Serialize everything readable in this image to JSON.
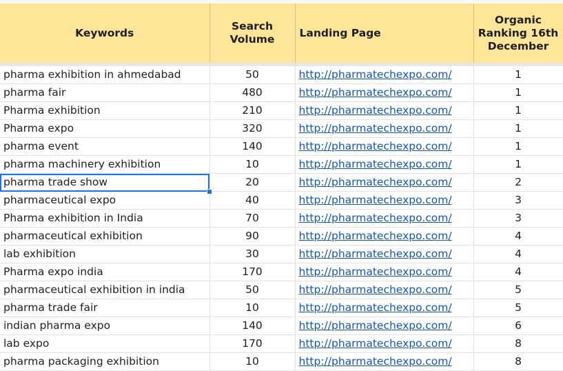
{
  "headers": {
    "keywords": "Keywords",
    "search_volume": "Search Volume",
    "landing_page": "Landing Page",
    "organic_ranking": "Organic Ranking 16th December"
  },
  "rows": [
    {
      "keyword": "pharma exhibition in ahmedabad",
      "volume": "50",
      "url": "http://pharmatechexpo.com/",
      "rank": "1"
    },
    {
      "keyword": "pharma fair",
      "volume": "480",
      "url": "http://pharmatechexpo.com/",
      "rank": "1"
    },
    {
      "keyword": "Pharma exhibition",
      "volume": "210",
      "url": "http://pharmatechexpo.com/",
      "rank": "1"
    },
    {
      "keyword": "Pharma expo",
      "volume": "320",
      "url": "http://pharmatechexpo.com/",
      "rank": "1"
    },
    {
      "keyword": "pharma event",
      "volume": "140",
      "url": "http://pharmatechexpo.com/",
      "rank": "1"
    },
    {
      "keyword": "pharma machinery exhibition",
      "volume": "10",
      "url": "http://pharmatechexpo.com/",
      "rank": "1"
    },
    {
      "keyword": "pharma trade show",
      "volume": "20",
      "url": "http://pharmatechexpo.com/",
      "rank": "2"
    },
    {
      "keyword": "pharmaceutical expo",
      "volume": "40",
      "url": "http://pharmatechexpo.com/",
      "rank": "3"
    },
    {
      "keyword": "Pharma exhibition in India",
      "volume": "70",
      "url": "http://pharmatechexpo.com/",
      "rank": "3"
    },
    {
      "keyword": "pharmaceutical exhibition",
      "volume": "90",
      "url": "http://pharmatechexpo.com/",
      "rank": "4"
    },
    {
      "keyword": "lab exhibition",
      "volume": "30",
      "url": "http://pharmatechexpo.com/",
      "rank": "4"
    },
    {
      "keyword": "Pharma expo india",
      "volume": "170",
      "url": "http://pharmatechexpo.com/",
      "rank": "4"
    },
    {
      "keyword": "pharmaceutical exhibition in india",
      "volume": "50",
      "url": "http://pharmatechexpo.com/",
      "rank": "5"
    },
    {
      "keyword": "pharma trade fair",
      "volume": "10",
      "url": "http://pharmatechexpo.com/",
      "rank": "5"
    },
    {
      "keyword": "indian pharma expo",
      "volume": "140",
      "url": "http://pharmatechexpo.com/",
      "rank": "6"
    },
    {
      "keyword": "lab expo",
      "volume": "170",
      "url": "http://pharmatechexpo.com/",
      "rank": "8"
    },
    {
      "keyword": "pharma packaging exhibition",
      "volume": "10",
      "url": "http://pharmatechexpo.com/",
      "rank": "8"
    }
  ],
  "selected_row": 6
}
